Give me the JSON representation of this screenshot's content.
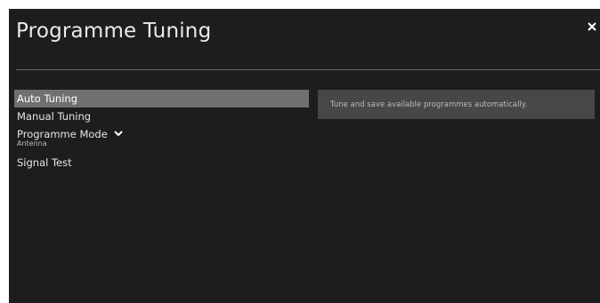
{
  "header": {
    "title": "Programme Tuning",
    "close_icon": "close-icon"
  },
  "menu": {
    "items": [
      {
        "label": "Auto Tuning",
        "selected": true
      },
      {
        "label": "Manual Tuning",
        "selected": false
      },
      {
        "label": "Programme Mode",
        "sub": "Antenna",
        "icon": "chevron-down-icon",
        "selected": false
      },
      {
        "label": "Signal Test",
        "selected": false
      }
    ]
  },
  "description": {
    "text": "Tune and save available programmes automatically."
  },
  "colors": {
    "background": "#1d1d1d",
    "selected_item": "#707070",
    "description_box": "#474747",
    "divider": "#6a6a6a"
  }
}
